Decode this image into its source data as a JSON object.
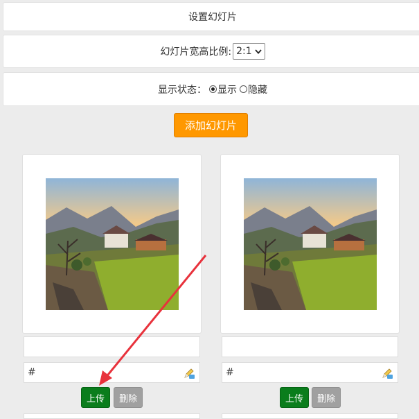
{
  "header": {
    "title": "设置幻灯片"
  },
  "ratio": {
    "label": "幻灯片宽高比例:",
    "selected": "2:1"
  },
  "visibility": {
    "label": "显示状态：",
    "options": [
      "显示",
      "隐藏"
    ],
    "selected": "显示"
  },
  "add_button": {
    "label": "添加幻灯片"
  },
  "slides": [
    {
      "link": "#",
      "upload_label": "上传",
      "delete_label": "删除"
    },
    {
      "link": "#",
      "upload_label": "上传",
      "delete_label": "删除"
    }
  ],
  "colors": {
    "accent": "#ff9800",
    "upload": "#0a7d1c",
    "delete": "#a0a0a0",
    "arrow": "#e8323c"
  },
  "icons": [
    "edit-icon",
    "chevron-down-icon"
  ]
}
